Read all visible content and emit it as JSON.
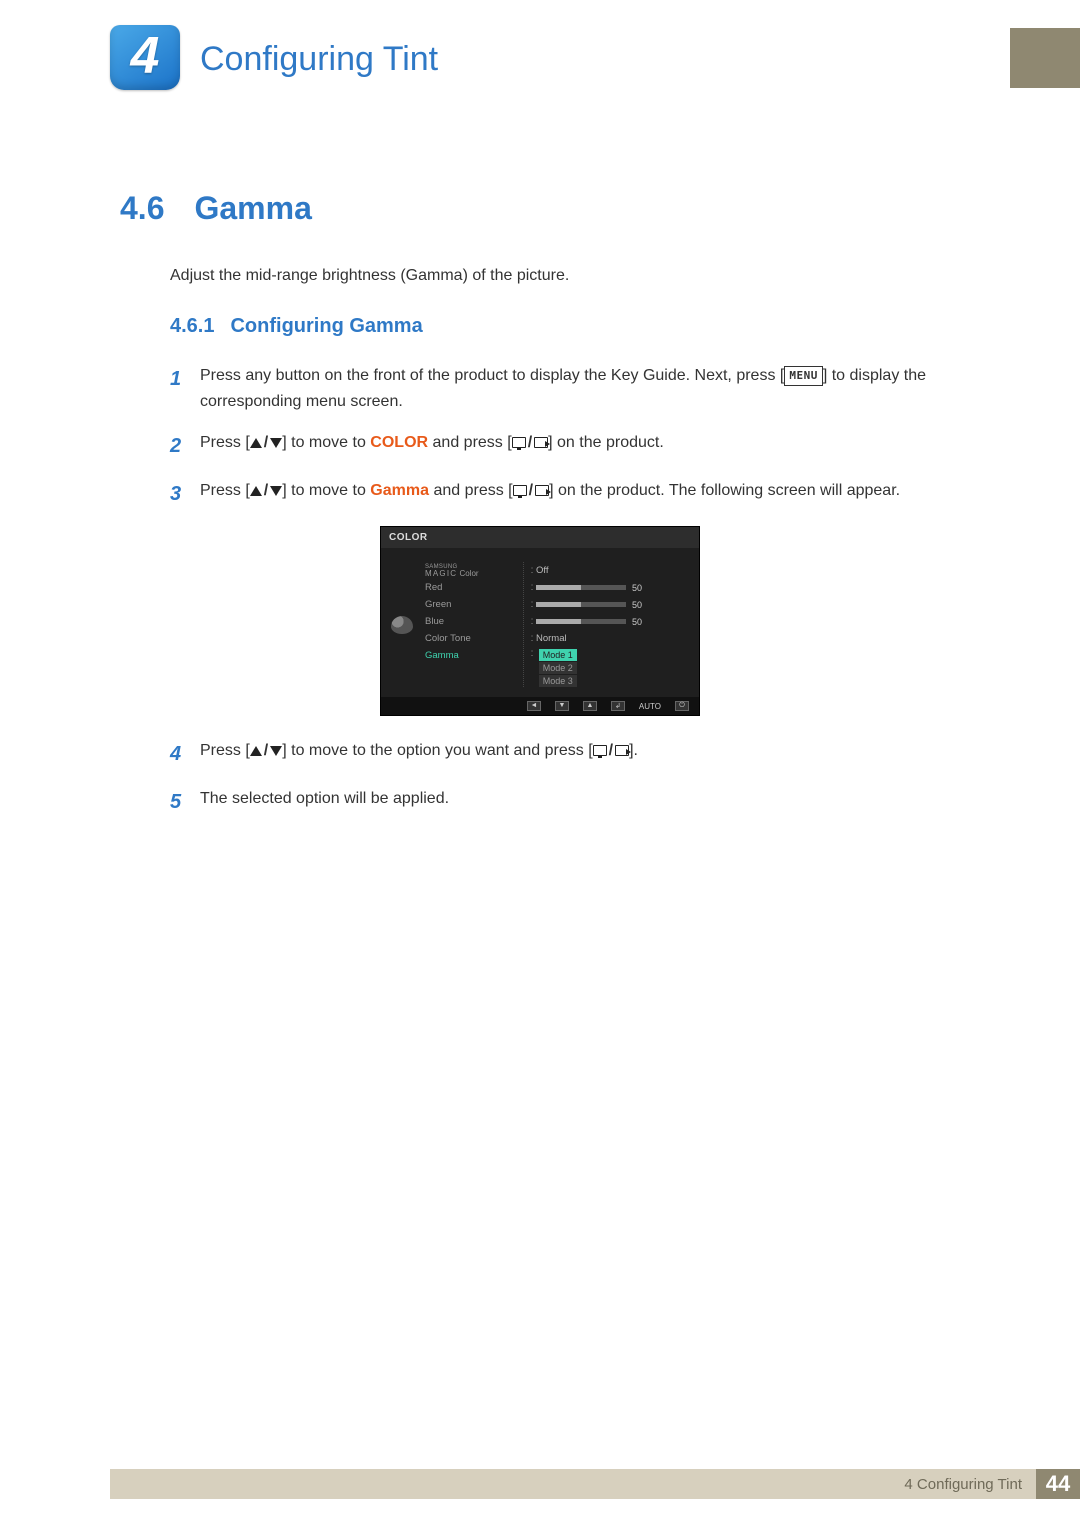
{
  "header": {
    "chapter_number": "4",
    "chapter_title": "Configuring Tint"
  },
  "section": {
    "number": "4.6",
    "title": "Gamma",
    "intro": "Adjust the mid-range brightness (Gamma) of the picture."
  },
  "subsection": {
    "number": "4.6.1",
    "title": "Configuring Gamma"
  },
  "buttons": {
    "menu": "MENU"
  },
  "steps": {
    "s1a": "Press any button on the front of the product to display the Key Guide. Next, press [",
    "s1b": "] to display the corresponding menu screen.",
    "s2a": "Press [",
    "s2b": "] to move to ",
    "s2c": "COLOR",
    "s2d": " and press [",
    "s2e": "] on the product.",
    "s3a": "Press [",
    "s3b": "] to move to ",
    "s3c": "Gamma",
    "s3d": " and press [",
    "s3e": "] on the product. The following screen will appear.",
    "s4a": "Press [",
    "s4b": "] to move to the option you want and press [",
    "s4c": "].",
    "s5": "The selected option will be applied."
  },
  "osd": {
    "title": "COLOR",
    "magic_top": "SAMSUNG",
    "magic_bottom": "MAGIC",
    "magic_suffix": " Color",
    "magic_value": "Off",
    "red": "Red",
    "green": "Green",
    "blue": "Blue",
    "color_tone": "Color Tone",
    "color_tone_value": "Normal",
    "gamma": "Gamma",
    "mode1": "Mode 1",
    "mode2": "Mode 2",
    "mode3": "Mode 3",
    "val50": "50",
    "auto": "AUTO"
  },
  "footer": {
    "text": "4 Configuring Tint",
    "page": "44"
  }
}
